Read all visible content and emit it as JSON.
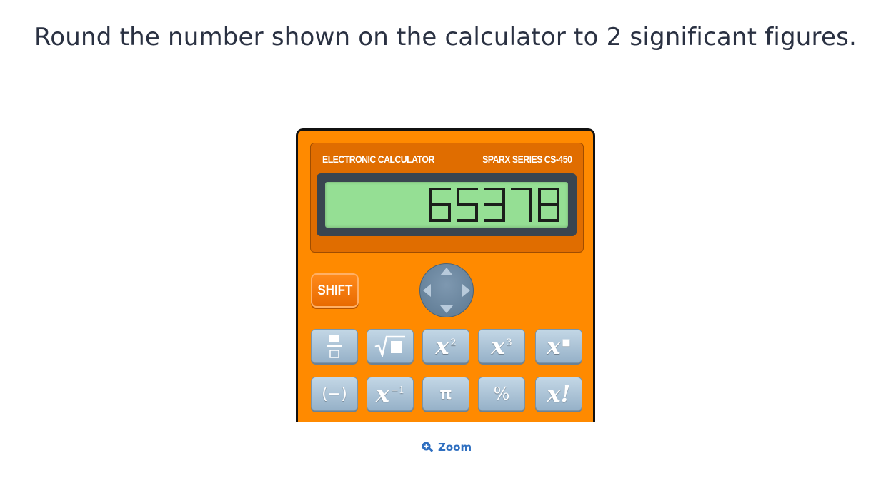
{
  "question": "Round the number shown on the calculator to 2 significant figures.",
  "calculator": {
    "brand_left": "ELECTRONIC CALCULATOR",
    "brand_right": "SPARX SERIES CS-450",
    "display_value": "65378",
    "shift_label": "SHIFT",
    "row1": [
      {
        "name": "fraction-button",
        "label": "fraction"
      },
      {
        "name": "sqrt-button",
        "label": "square root"
      },
      {
        "name": "x-squared-button",
        "base": "x",
        "sup": "2"
      },
      {
        "name": "x-cubed-button",
        "base": "x",
        "sup": "3"
      },
      {
        "name": "x-power-button",
        "base": "x",
        "sup": "■"
      }
    ],
    "row2": [
      {
        "name": "negative-button",
        "label": "(−)"
      },
      {
        "name": "x-inverse-button",
        "base": "x",
        "sup": "−1"
      },
      {
        "name": "pi-button",
        "label": "π"
      },
      {
        "name": "percent-button",
        "label": "%"
      },
      {
        "name": "factorial-button",
        "label": "x!"
      }
    ]
  },
  "zoom": {
    "label": "Zoom",
    "icon": "zoom-in-icon"
  },
  "colors": {
    "calculator_body": "#ff8a00",
    "display": "#95df94",
    "link": "#2f6fc0"
  }
}
